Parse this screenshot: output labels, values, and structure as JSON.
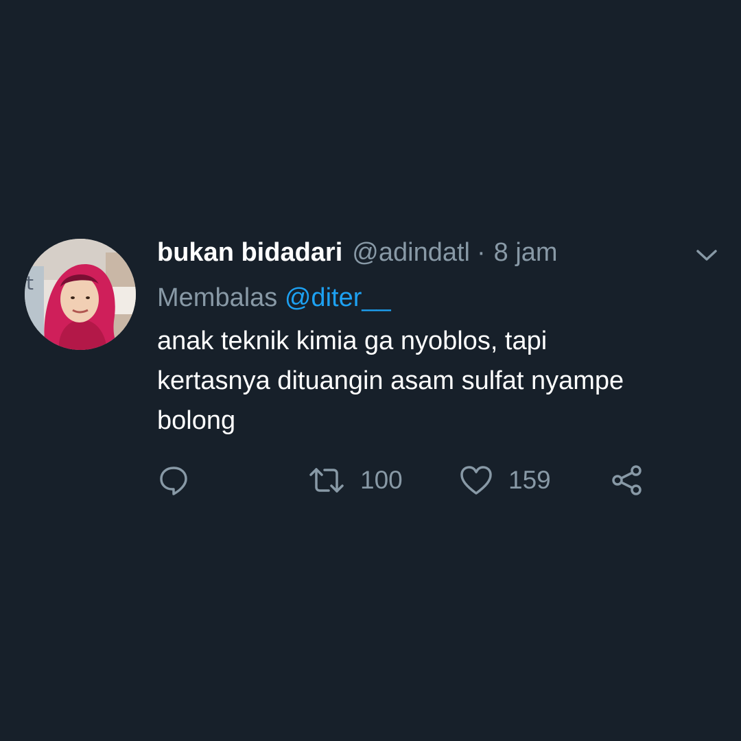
{
  "tweet": {
    "author": {
      "display_name": "bukan bidadari",
      "handle": "@adindatl"
    },
    "separator": "·",
    "timestamp": "8 jam",
    "reply_prefix": "Membalas",
    "reply_to": "@diter__",
    "text_lines": [
      "anak teknik kimia ga nyoblos, tapi",
      "kertasnya dituangin asam sulfat nyampe",
      "bolong"
    ],
    "retweet_count": "100",
    "like_count": "159"
  },
  "icons": {
    "more": "chevron-down-icon",
    "reply": "comment-icon",
    "retweet": "retweet-icon",
    "like": "heart-icon",
    "share": "share-icon"
  },
  "colors": {
    "background": "#17202a",
    "text_primary": "#ffffff",
    "text_secondary": "#8899a6",
    "accent": "#1da1f2"
  }
}
